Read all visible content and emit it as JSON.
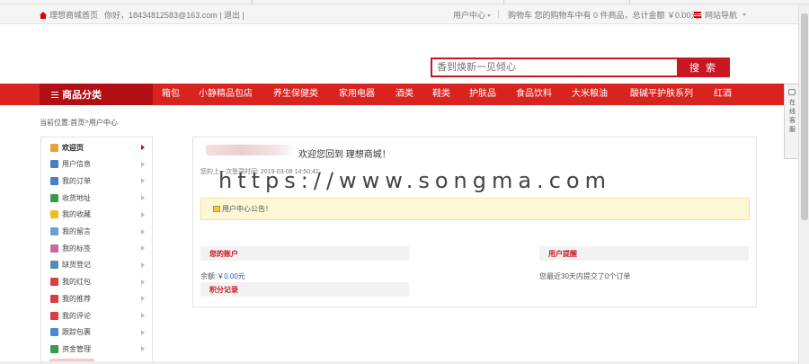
{
  "topbar": {
    "home_label": "理想商城首页",
    "greeting": "你好，18434812583@163.com | 退出 |",
    "user_center": "用户中心",
    "cart_text": "购物车 您的购物车中有 0 件商品，总计金额 ￥0.00元。",
    "site_nav": "网站导航"
  },
  "search": {
    "placeholder": "香到焕新一见倾心",
    "button_label": "搜 索"
  },
  "nav": {
    "category_label": "商品分类",
    "items": [
      "箱包",
      "小静精品包店",
      "养生保健类",
      "家用电器",
      "酒类",
      "鞋类",
      "护肤品",
      "食品饮料",
      "大米粮油",
      "酸碱平护肤系列",
      "红酒"
    ]
  },
  "breadcrumb": {
    "prefix": "当前位置:",
    "home": "首页",
    "sep": ">",
    "current": "用户中心"
  },
  "sidebar": {
    "items": [
      {
        "label": "欢迎页",
        "icon": "home-icon",
        "color": "#e9a23b"
      },
      {
        "label": "用户信息",
        "icon": "user-info-icon",
        "color": "#4a7fc8"
      },
      {
        "label": "我的订单",
        "icon": "order-icon",
        "color": "#4a7fc8"
      },
      {
        "label": "收货地址",
        "icon": "address-icon",
        "color": "#3a9a4a"
      },
      {
        "label": "我的收藏",
        "icon": "star-icon",
        "color": "#f1b92a"
      },
      {
        "label": "我的留言",
        "icon": "message-icon",
        "color": "#6aa0d8"
      },
      {
        "label": "我的标签",
        "icon": "tag-icon",
        "color": "#c86aa0"
      },
      {
        "label": "缺货登记",
        "icon": "register-icon",
        "color": "#5a8ab8"
      },
      {
        "label": "我的红包",
        "icon": "red-packet-icon",
        "color": "#d84040"
      },
      {
        "label": "我的推荐",
        "icon": "recommend-icon",
        "color": "#d84040"
      },
      {
        "label": "我的评论",
        "icon": "comment-flag-icon",
        "color": "#d84040"
      },
      {
        "label": "跟踪包裹",
        "icon": "track-package-icon",
        "color": "#4a8ad8"
      },
      {
        "label": "资金管理",
        "icon": "funds-icon",
        "color": "#3a9a4a"
      }
    ]
  },
  "content": {
    "welcome": "欢迎您回到 理想商城！",
    "last_login": "您的上一次登录时间: 2019-03-08 14:50:42",
    "watermark": "https://www.songma.com",
    "notice": "用户中心公告！",
    "account_header": "您的账户",
    "balance_label": "余额:",
    "balance_value": "￥0.00元",
    "records_header": "积分记录",
    "reminder_header": "用户提醒",
    "orders_text": "您最近30天内提交了0个订单"
  },
  "float_tab": {
    "label": "在线客服"
  }
}
